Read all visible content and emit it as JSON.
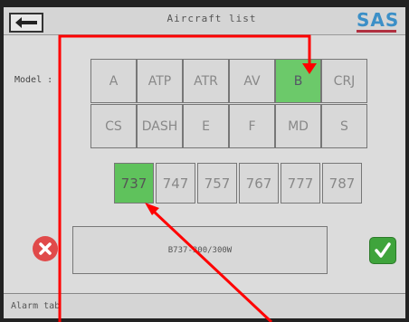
{
  "header": {
    "title": "Aircraft list",
    "logo": "SAS"
  },
  "model_label": "Model :",
  "models": [
    [
      "A",
      "ATP",
      "ATR",
      "AV",
      "B",
      "CRJ"
    ],
    [
      "CS",
      "DASH",
      "E",
      "F",
      "MD",
      "S"
    ]
  ],
  "selected_model": "B",
  "types": [
    "737",
    "747",
    "757",
    "767",
    "777",
    "787"
  ],
  "selected_type": "737",
  "selection_text": "B737-300/300W",
  "footer": {
    "alarm_tab": "Alarm tab"
  },
  "colors": {
    "selected": "#6cc96a",
    "cancel": "#e04a4a",
    "confirm": "#3fa43c",
    "annotation": "#ff0000"
  },
  "icons": {
    "back": "arrow-left-icon",
    "cancel": "x-circle-icon",
    "confirm": "check-icon"
  }
}
